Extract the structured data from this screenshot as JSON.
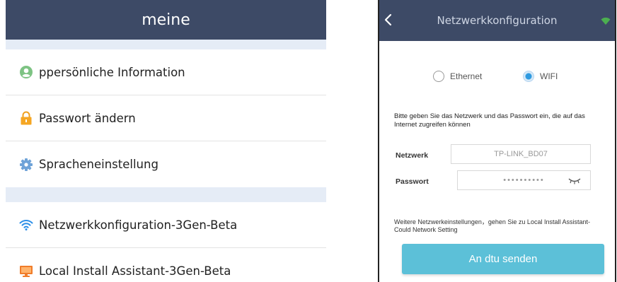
{
  "left": {
    "header_title": "meine",
    "items": [
      {
        "label": "ppersönliche Information",
        "icon": "user-circle-icon"
      },
      {
        "label": "Passwort ändern",
        "icon": "lock-icon"
      },
      {
        "label": "Spracheneinstellung",
        "icon": "gear-icon"
      },
      {
        "label": "Netzwerkkonfiguration-3Gen-Beta",
        "icon": "wifi-icon"
      },
      {
        "label": "Local Install Assistant-3Gen-Beta",
        "icon": "monitor-icon"
      }
    ]
  },
  "right": {
    "header_title": "Netzwerkkonfiguration",
    "radio_ethernet": "Ethernet",
    "radio_wifi": "WIFI",
    "selected_mode": "WIFI",
    "description": "Bitte geben Sie das Netzwerk und das Passwort ein, die auf das Internet zugreifen können",
    "network_label": "Netzwerk",
    "network_value": "TP-LINK_BD07",
    "password_label": "Passwort",
    "password_value": "••••••••••",
    "note": "Weitere Netzwerkeinstellungen，gehen Sie zu Local Install Assistant-Could Network Setting",
    "send_button": "An dtu senden"
  },
  "colors": {
    "header": "#3d4a66",
    "spacer": "#e5ecf6",
    "button": "#5cc0d8",
    "radio_selected": "#2e9ae0"
  }
}
